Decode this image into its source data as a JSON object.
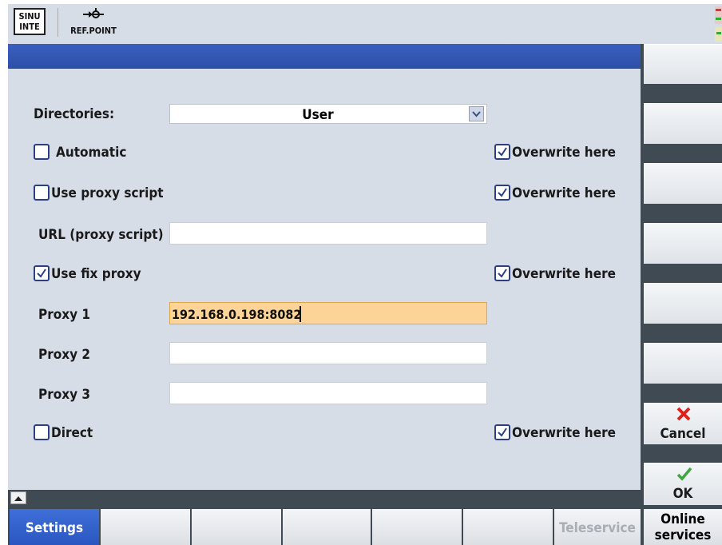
{
  "header": {
    "logo_text_line1": "SINU",
    "logo_text_line2": "INTE",
    "refpoint_label": "REF.POINT"
  },
  "form": {
    "directories_label": "Directories:",
    "directories_value": "User",
    "automatic_label": "Automatic",
    "automatic_checked": false,
    "use_proxy_script_label": "Use proxy script",
    "use_proxy_script_checked": false,
    "url_proxy_script_label": "URL (proxy script)",
    "url_proxy_script_value": "",
    "use_fix_proxy_label": "Use fix proxy",
    "use_fix_proxy_checked": true,
    "proxy1_label": "Proxy 1",
    "proxy1_value": "192.168.0.198:8082",
    "proxy2_label": "Proxy 2",
    "proxy2_value": "",
    "proxy3_label": "Proxy 3",
    "proxy3_value": "",
    "direct_label": "Direct",
    "direct_checked": false,
    "overwrite_label": "Overwrite here"
  },
  "softkeys": {
    "cancel_label": "Cancel",
    "ok_label": "OK"
  },
  "bottom": {
    "settings_label": "Settings",
    "teleservice_label": "Teleservice",
    "online_services_line1": "Online",
    "online_services_line2": "services"
  },
  "colors": {
    "accent": "#2a56c0",
    "active_field": "#fdd497",
    "cancel_icon": "#e0201a",
    "ok_icon": "#3aa83a"
  }
}
